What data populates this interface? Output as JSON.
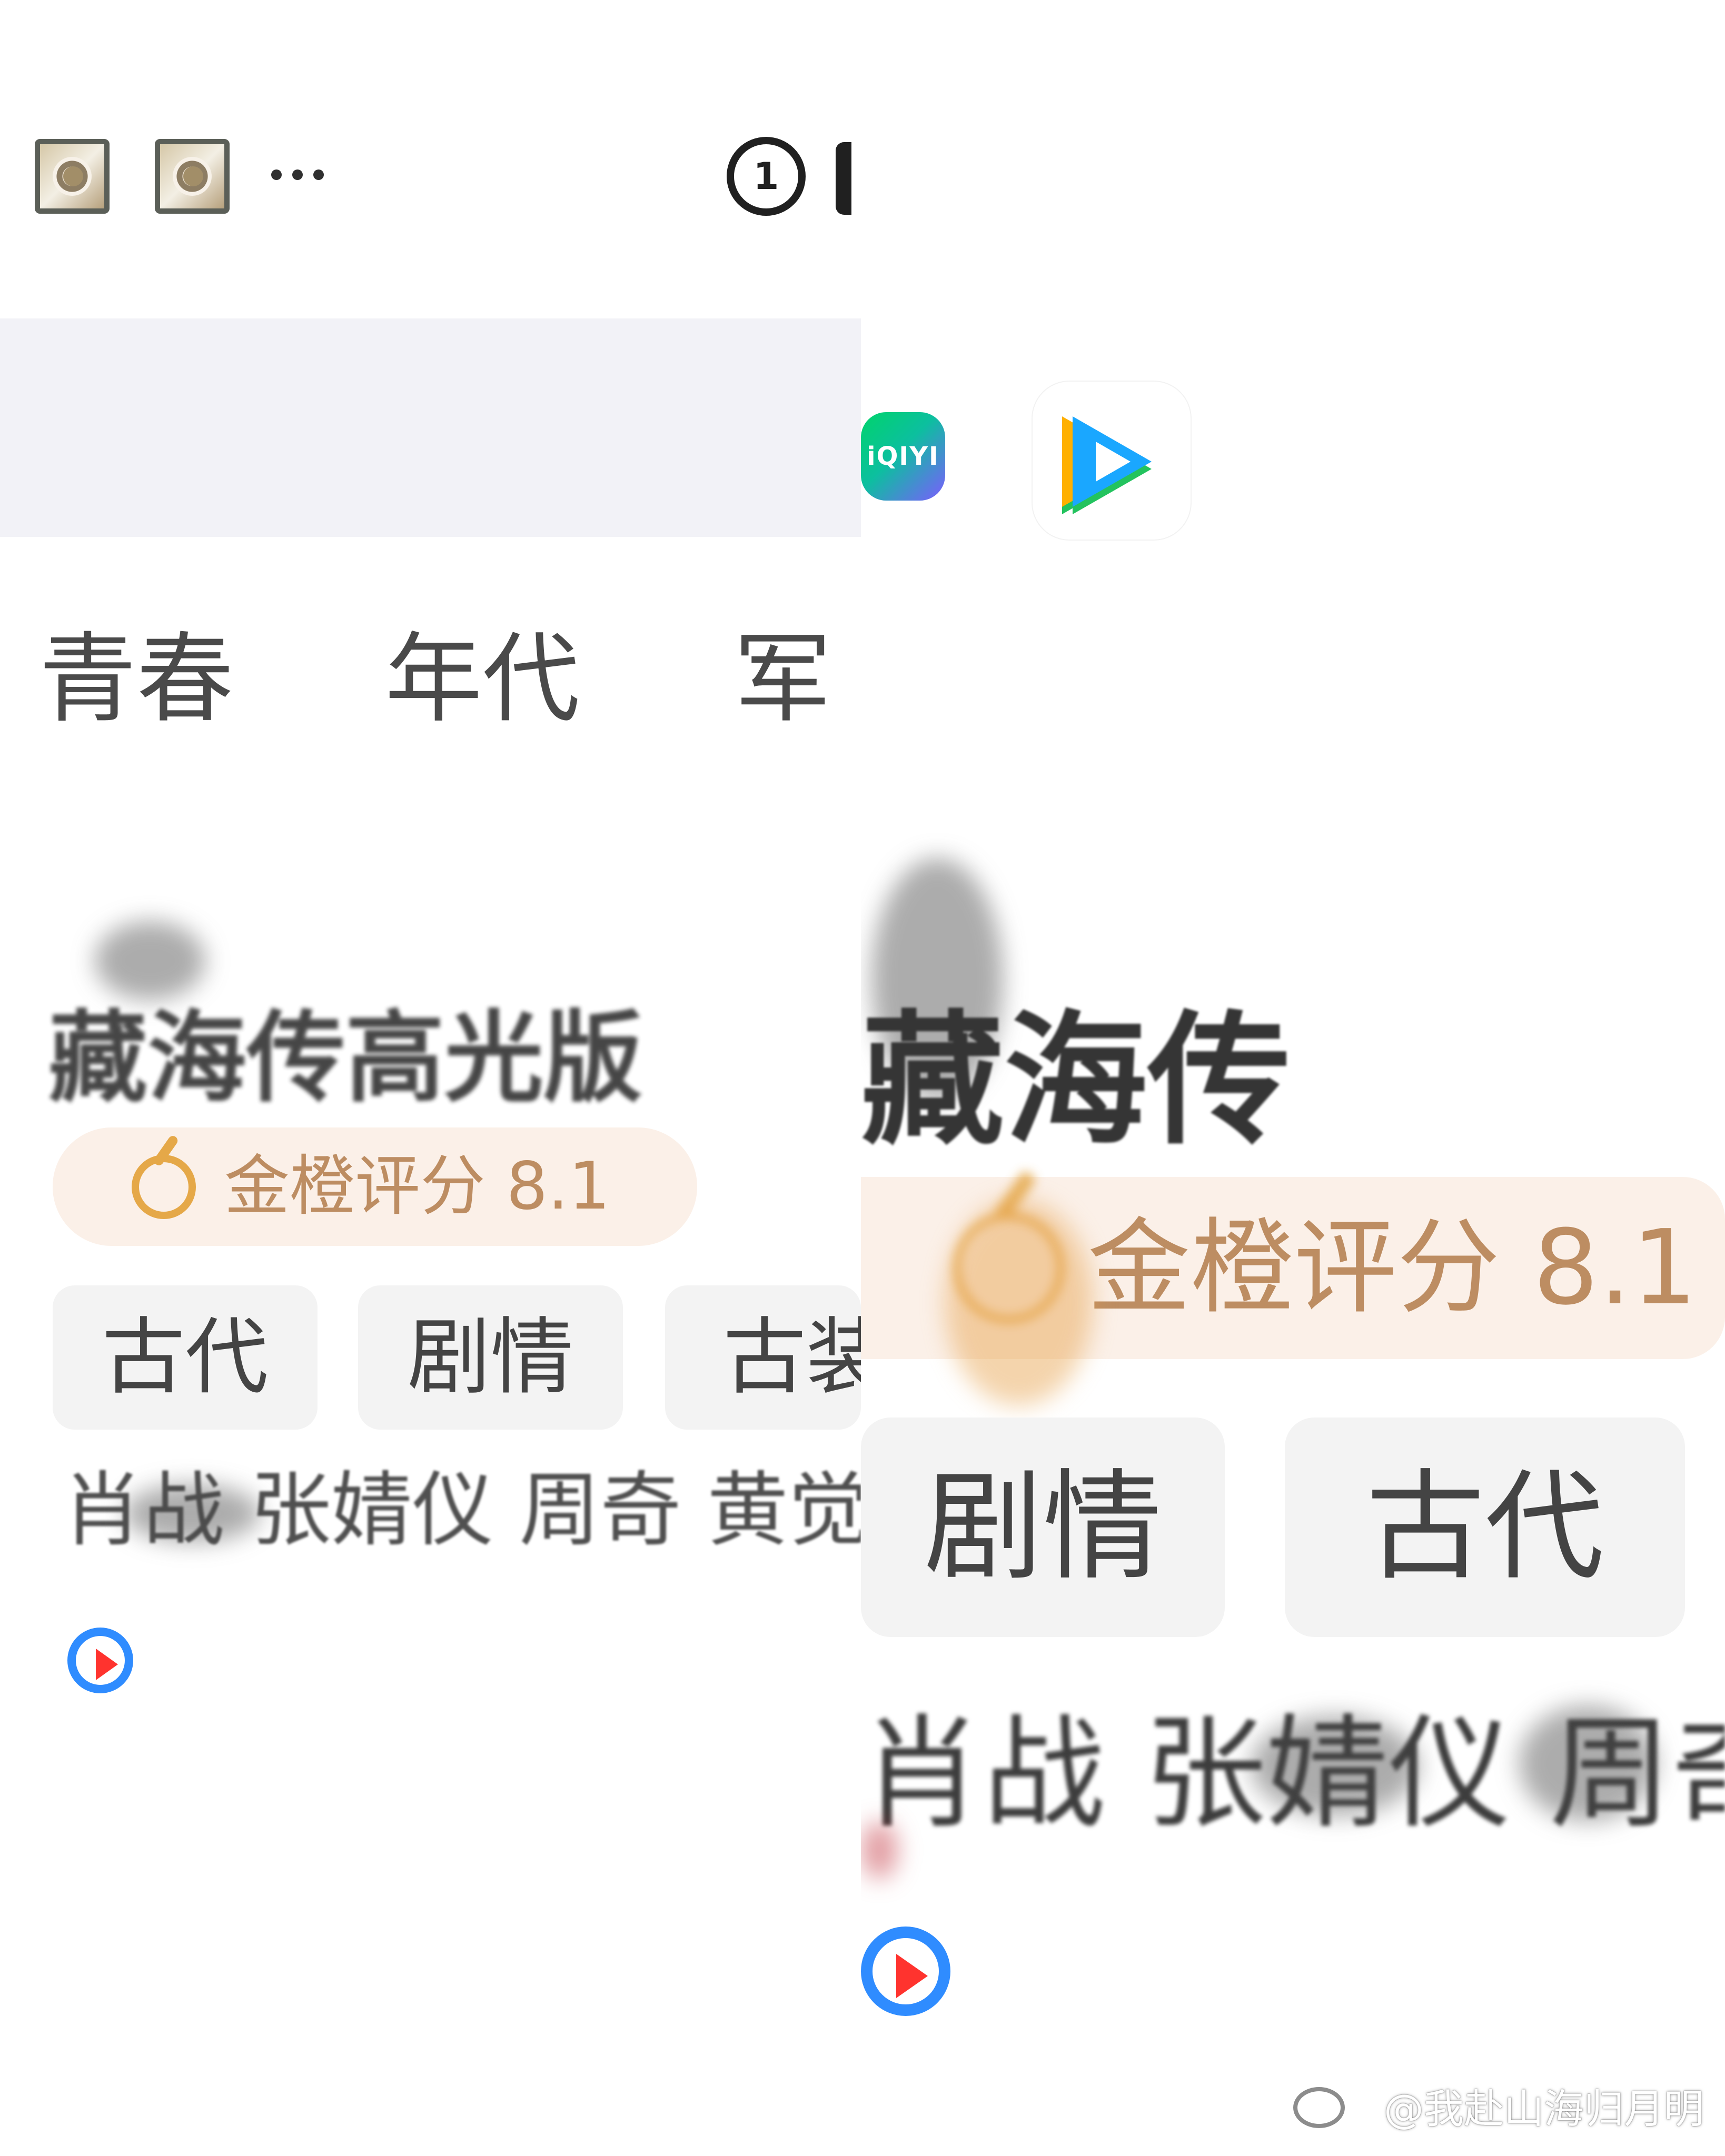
{
  "left_panel": {
    "category_tabs": [
      "青春",
      "年代",
      "军"
    ],
    "title": "藏海传高光版",
    "rating": {
      "label": "金橙评分 8.1",
      "accent_color": "#bd8d62",
      "icon": "orange-rating-icon"
    },
    "tags": [
      "古代",
      "剧情",
      "古装"
    ],
    "cast": "肖战 张婧仪 周奇 黄觉 余",
    "play_icon": "youku-play-icon"
  },
  "header": {
    "avatar_icons": [
      "profile-badge-icon",
      "profile-badge-icon"
    ],
    "more_icon": "more-horizontal-icon",
    "brand_icon": "app-logo-icon",
    "brand_text": "1"
  },
  "right_panel": {
    "app_icons": [
      {
        "name": "iqiyi-app-icon",
        "label": "iQIYI"
      },
      {
        "name": "tencent-video-app-icon",
        "label": ""
      }
    ],
    "title": "藏海传",
    "rating": {
      "label": "金橙评分 8.1",
      "accent_color": "#bd8d62",
      "icon": "orange-rating-icon"
    },
    "tags": [
      "剧情",
      "古代"
    ],
    "cast": "肖战 张婧仪 周奇",
    "play_icon": "youku-play-icon"
  },
  "watermark": {
    "text": "@我赴山海归月明"
  }
}
